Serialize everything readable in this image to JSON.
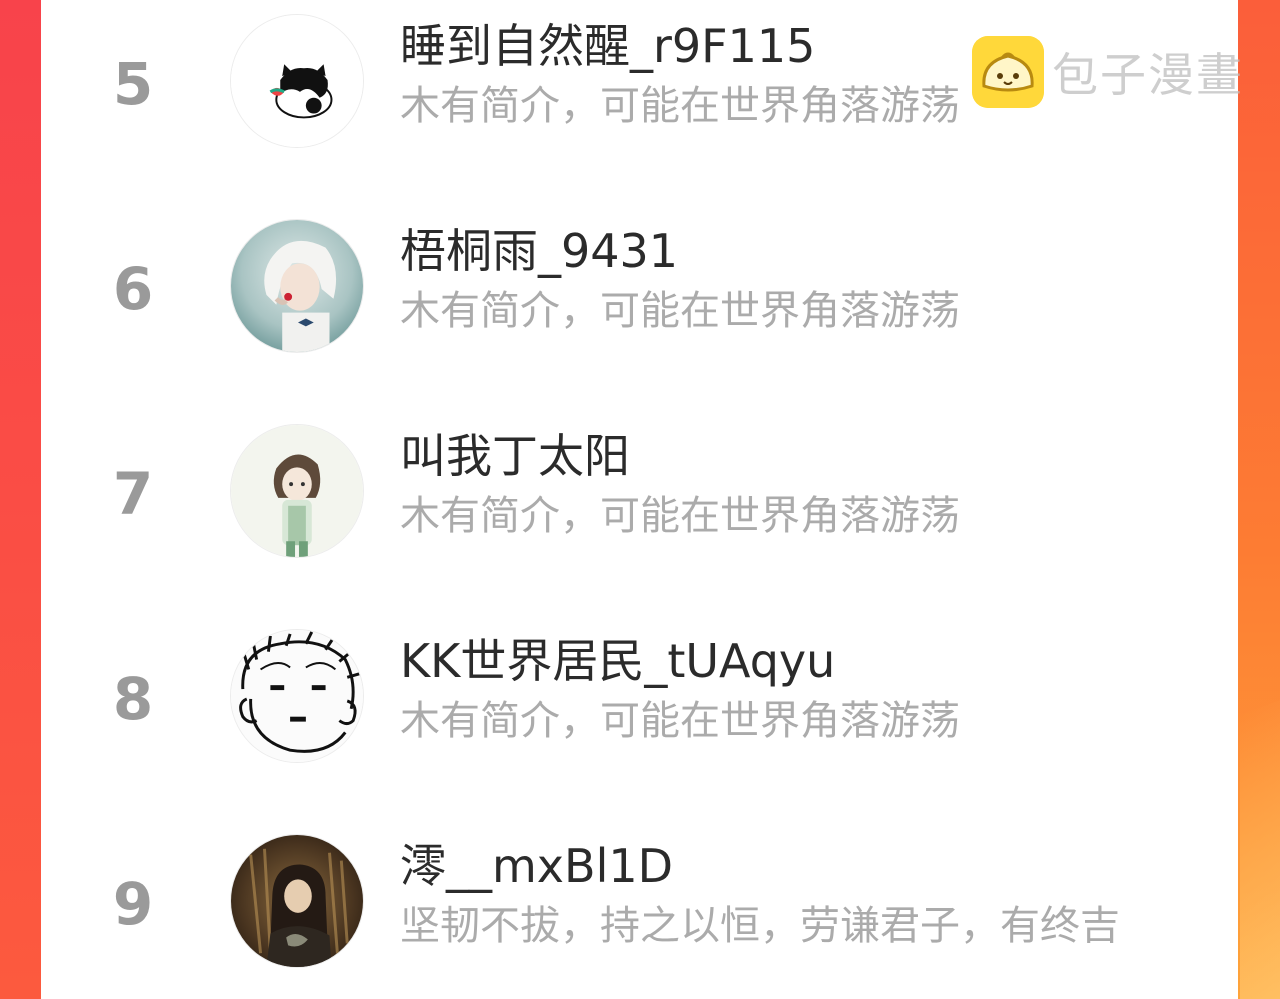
{
  "watermark": {
    "text": "包子漫畫",
    "logo_icon": "bun-logo-icon",
    "logo_color": "#ffd83a"
  },
  "theme": {
    "border_left": "#f8434b",
    "border_right": "#fd7c33",
    "rank_color": "#9a9a9a",
    "name_color": "#2b2b2b",
    "bio_color": "#ababab"
  },
  "ranking": [
    {
      "rank": "5",
      "username": "睡到自然醒_r9F115",
      "bio": "木有简介，可能在世界角落游荡",
      "avatar_icon": "cat-avatar-icon"
    },
    {
      "rank": "6",
      "username": "梧桐雨_9431",
      "bio": "木有简介，可能在世界角落游荡",
      "avatar_icon": "anime-white-hair-avatar-icon"
    },
    {
      "rank": "7",
      "username": "叫我丁太阳",
      "bio": "木有简介，可能在世界角落游荡",
      "avatar_icon": "anime-girl-green-avatar-icon"
    },
    {
      "rank": "8",
      "username": "KK世界居民_tUAqyu",
      "bio": "木有简介，可能在世界角落游荡",
      "avatar_icon": "sketch-face-avatar-icon"
    },
    {
      "rank": "9",
      "username": "澪__mxBl1D",
      "bio": "坚韧不拔，持之以恒，劳谦君子，有终吉",
      "avatar_icon": "dark-anime-avatar-icon"
    }
  ]
}
